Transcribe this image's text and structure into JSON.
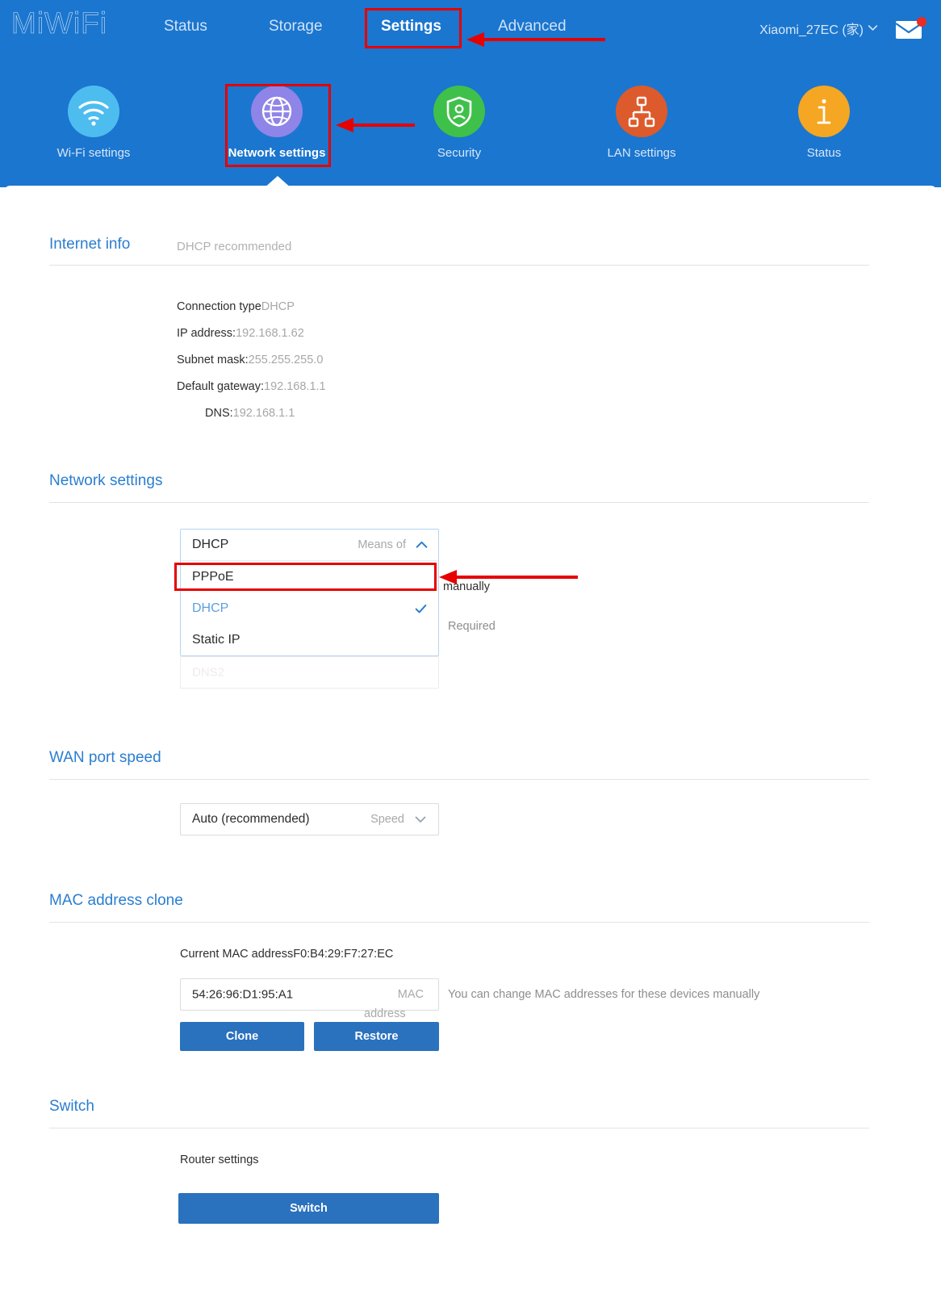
{
  "header": {
    "brand": "MiWiFi",
    "nav": [
      {
        "label": "Status",
        "active": false
      },
      {
        "label": "Storage",
        "active": false
      },
      {
        "label": "Settings",
        "active": true
      },
      {
        "label": "Advanced",
        "active": false
      }
    ],
    "account": "Xiaomi_27EC (家)",
    "account_caret_icon": "chevron-down-icon",
    "mail_icon": "envelope-icon",
    "mail_badge": true
  },
  "icon_nav": [
    {
      "label": "Wi-Fi settings",
      "icon": "wifi-icon",
      "color": "#4dbdf0",
      "selected": false
    },
    {
      "label": "Network settings",
      "icon": "globe-icon",
      "color": "#8f84e8",
      "selected": true
    },
    {
      "label": "Security",
      "icon": "shield-icon",
      "color": "#3fc04a",
      "selected": false
    },
    {
      "label": "LAN settings",
      "icon": "network-icon",
      "color": "#dd5a2c",
      "selected": false
    },
    {
      "label": "Status",
      "icon": "info-icon",
      "color": "#f5a623",
      "selected": false
    }
  ],
  "internet_info": {
    "title": "Internet info",
    "note": "DHCP recommended",
    "rows": [
      {
        "label": "Connection type",
        "value": "DHCP"
      },
      {
        "label": "IP address:",
        "value": "192.168.1.62"
      },
      {
        "label": "Subnet mask:",
        "value": "255.255.255.0"
      },
      {
        "label": "Default gateway:",
        "value": "192.168.1.1"
      },
      {
        "label": "DNS:",
        "value": "192.168.1.1"
      }
    ]
  },
  "network_settings": {
    "title": "Network settings",
    "dropdown": {
      "selected": "DHCP",
      "hint": "Means of",
      "chevron_icon": "chevron-up-icon",
      "options": [
        {
          "label": "PPPoE",
          "current": false,
          "highlighted": true
        },
        {
          "label": "DHCP",
          "current": true,
          "highlighted": false
        },
        {
          "label": "Static IP",
          "current": false,
          "highlighted": false
        }
      ]
    },
    "ghost_field_placeholder": "DNS2",
    "note_manually": "manually",
    "note_required": "Required"
  },
  "wan_port_speed": {
    "title": "WAN port speed",
    "selected": "Auto (recommended)",
    "hint": "Speed",
    "chevron_icon": "chevron-down-icon"
  },
  "mac_clone": {
    "title": "MAC address clone",
    "current_label": "Current MAC address",
    "current_value": "F0:B4:29:F7:27:EC",
    "input_value": "54:26:96:D1:95:A1",
    "input_suffix_line1": "MAC",
    "input_suffix_line2": "address",
    "side_note": "You can change MAC addresses for these devices manually",
    "clone_button": "Clone",
    "restore_button": "Restore"
  },
  "switch_section": {
    "title": "Switch",
    "label": "Router settings",
    "button": "Switch"
  },
  "colors": {
    "header_blue": "#1b76cf",
    "accent_blue": "#2a7ed0",
    "button_blue": "#2a71be",
    "annotation_red": "#e60000"
  }
}
